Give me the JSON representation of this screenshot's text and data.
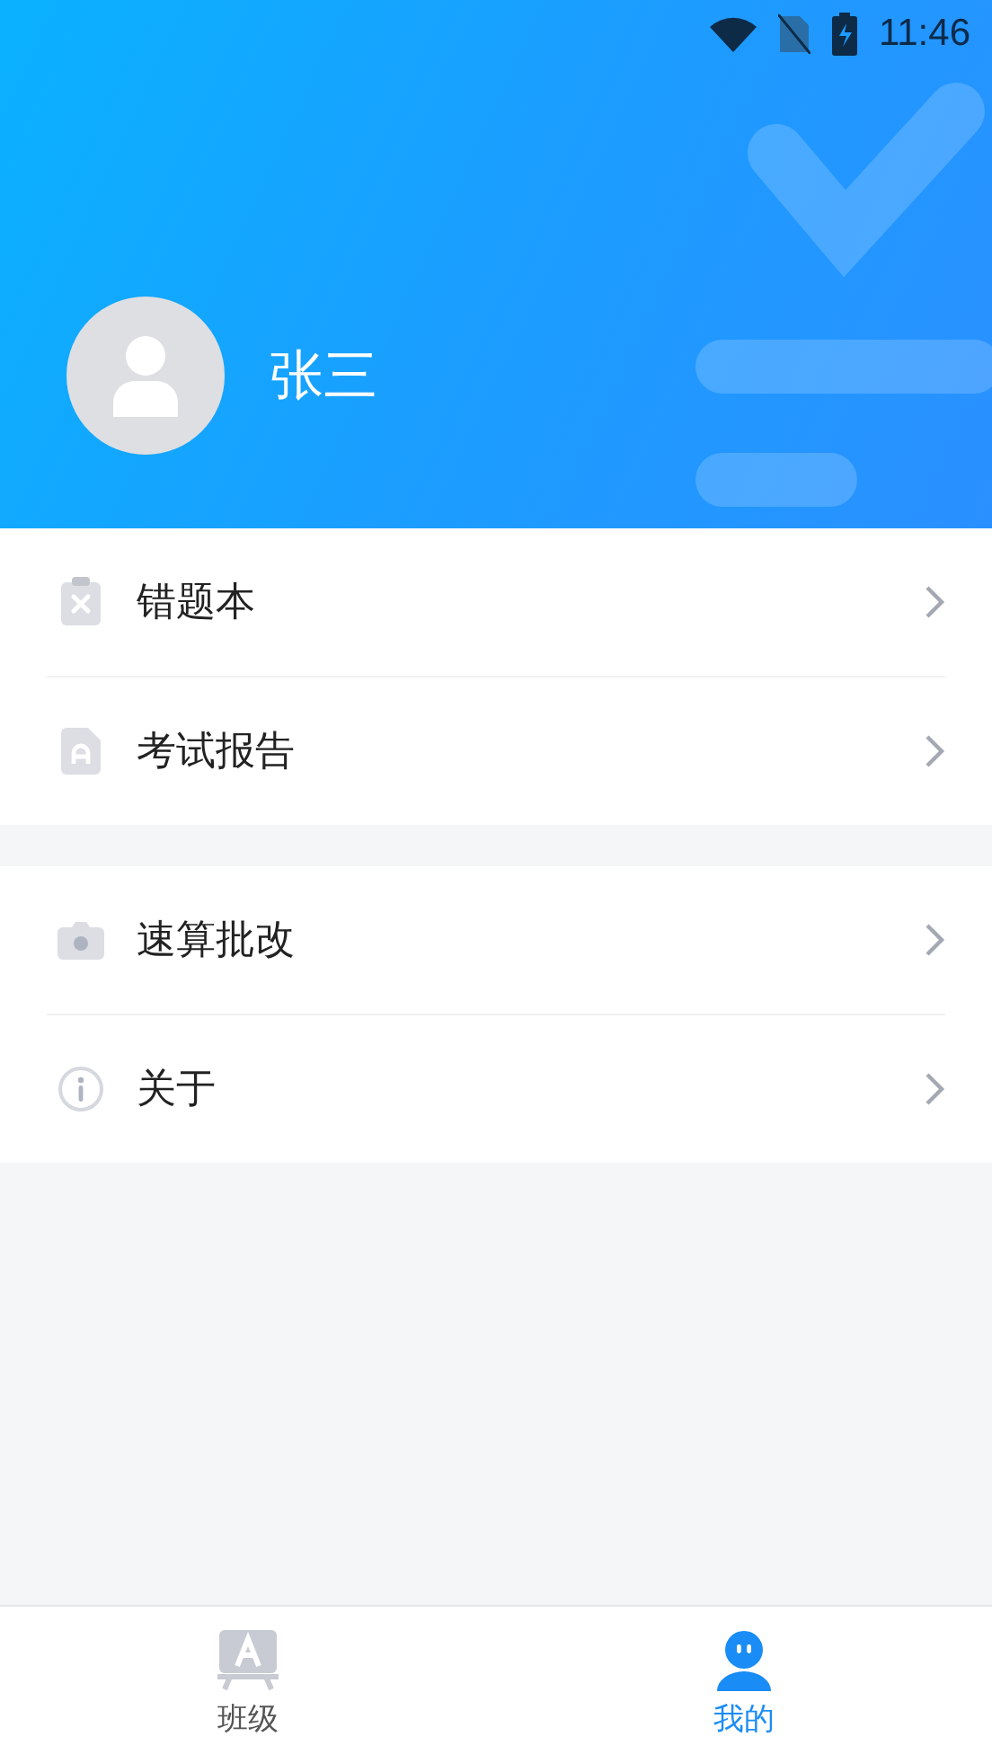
{
  "status_bar": {
    "time": "11:46"
  },
  "profile": {
    "name": "张三"
  },
  "menu_groups": [
    {
      "items": [
        {
          "kind": "wrong",
          "label": "错题本"
        },
        {
          "kind": "report",
          "label": "考试报告"
        }
      ]
    },
    {
      "items": [
        {
          "kind": "camera",
          "label": "速算批改"
        },
        {
          "kind": "info",
          "label": "关于"
        }
      ]
    }
  ],
  "tabs": [
    {
      "kind": "class",
      "label": "班级",
      "selected": false
    },
    {
      "kind": "me",
      "label": "我的",
      "selected": true
    }
  ]
}
